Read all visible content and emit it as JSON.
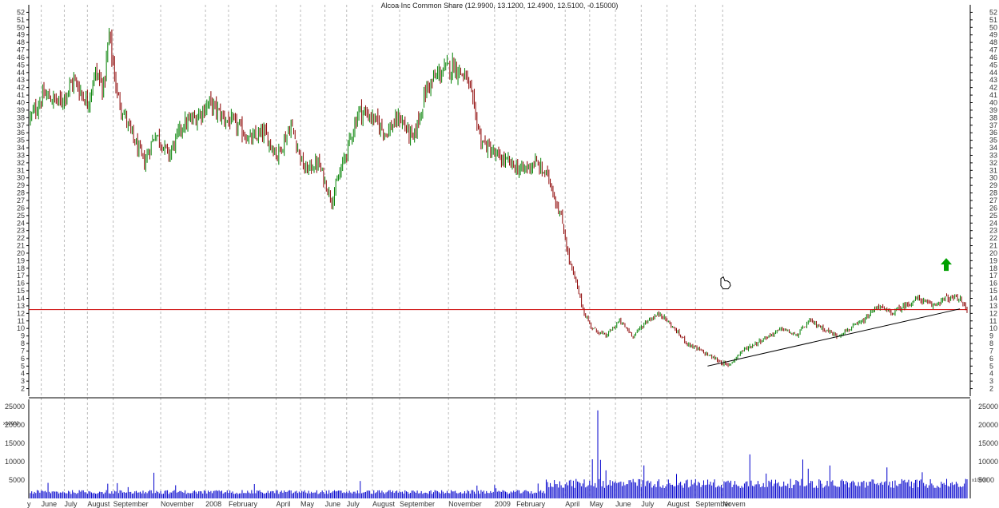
{
  "chart_data": [
    {
      "type": "candlestick",
      "title": "Alcoa Inc Common Share (12.9900, 13.1200, 12.4900, 12.5100, -0.15000)",
      "ylim": [
        1,
        53
      ],
      "y_ticks": [
        "2",
        "3",
        "4",
        "5",
        "6",
        "7",
        "8",
        "9",
        "10",
        "11",
        "12",
        "13",
        "14",
        "15",
        "16",
        "17",
        "18",
        "19",
        "20",
        "21",
        "22",
        "23",
        "24",
        "25",
        "26",
        "27",
        "28",
        "29",
        "30",
        "31",
        "32",
        "33",
        "34",
        "35",
        "36",
        "37",
        "38",
        "39",
        "40",
        "41",
        "42",
        "43",
        "44",
        "45",
        "46",
        "47",
        "48",
        "49",
        "50",
        "51",
        "52"
      ],
      "x_labels": [
        "y",
        "June",
        "July",
        "August",
        "September",
        "November",
        "2008",
        "February",
        "April",
        "May",
        "June",
        "July",
        "August",
        "September",
        "November",
        "2009",
        "February",
        "April",
        "May",
        "June",
        "July",
        "August",
        "September",
        "Novem"
      ],
      "bars_per_label_gap": [
        8,
        17,
        17,
        19,
        35,
        33,
        17,
        35,
        18,
        18,
        16,
        19,
        20,
        36,
        34,
        16,
        36,
        18,
        19,
        19,
        19,
        21,
        20
      ],
      "price_path": [
        [
          0,
          38
        ],
        [
          10,
          41
        ],
        [
          22,
          40
        ],
        [
          32,
          43
        ],
        [
          42,
          40
        ],
        [
          48,
          44
        ],
        [
          54,
          42
        ],
        [
          58,
          49
        ],
        [
          64,
          41
        ],
        [
          74,
          36
        ],
        [
          84,
          32
        ],
        [
          92,
          36
        ],
        [
          102,
          33
        ],
        [
          112,
          37
        ],
        [
          122,
          38
        ],
        [
          132,
          40
        ],
        [
          142,
          38
        ],
        [
          152,
          37
        ],
        [
          162,
          35
        ],
        [
          172,
          36
        ],
        [
          182,
          33
        ],
        [
          192,
          37
        ],
        [
          202,
          31
        ],
        [
          212,
          32
        ],
        [
          222,
          27
        ],
        [
          232,
          33
        ],
        [
          242,
          39
        ],
        [
          252,
          38
        ],
        [
          262,
          36
        ],
        [
          272,
          38
        ],
        [
          282,
          35
        ],
        [
          292,
          42
        ],
        [
          302,
          44
        ],
        [
          312,
          45
        ],
        [
          322,
          43
        ],
        [
          332,
          35
        ],
        [
          342,
          33
        ],
        [
          352,
          32
        ],
        [
          362,
          31
        ],
        [
          372,
          32
        ],
        [
          382,
          30
        ],
        [
          392,
          24
        ],
        [
          397,
          19
        ],
        [
          402,
          16
        ],
        [
          408,
          12
        ],
        [
          414,
          10
        ],
        [
          424,
          9
        ],
        [
          434,
          11
        ],
        [
          444,
          9
        ],
        [
          454,
          11
        ],
        [
          464,
          12
        ],
        [
          474,
          10
        ],
        [
          484,
          8
        ],
        [
          494,
          7
        ],
        [
          504,
          6
        ],
        [
          514,
          5
        ],
        [
          524,
          7
        ],
        [
          534,
          8
        ],
        [
          544,
          9
        ],
        [
          554,
          10
        ],
        [
          564,
          9
        ],
        [
          574,
          11
        ],
        [
          584,
          10
        ],
        [
          594,
          9
        ],
        [
          604,
          10
        ],
        [
          614,
          11
        ],
        [
          624,
          13
        ],
        [
          634,
          12
        ],
        [
          644,
          13
        ],
        [
          654,
          14
        ],
        [
          664,
          13
        ],
        [
          674,
          14
        ],
        [
          684,
          14
        ],
        [
          690,
          12.5
        ]
      ],
      "trendline": {
        "from": [
          0.721,
          5.0
        ],
        "to": [
          0.989,
          12.6
        ]
      },
      "horizontal_line": 12.5,
      "annotations": [
        "up-arrow",
        "hand-pointer"
      ]
    },
    {
      "type": "bar",
      "title": "Volume",
      "scale_note": "x10000",
      "ylim": [
        0,
        27000
      ],
      "y_ticks": [
        "5000",
        "10000",
        "15000",
        "20000",
        "25000"
      ],
      "peaks": [
        {
          "near_label": "September",
          "year": "2007",
          "value": 7000
        },
        {
          "near_label": "February",
          "year": "2009",
          "value": 24000
        },
        {
          "near_label": "February",
          "year": "2009",
          "value": 10500
        },
        {
          "near_label": "July",
          "year": "2009",
          "value": 9000
        },
        {
          "near_label": "September",
          "year": "2009",
          "value": 12000
        }
      ]
    }
  ],
  "colors": {
    "up": "#008000",
    "down": "#8b0000",
    "volume": "#0000cc",
    "hline": "#cc0000",
    "trend": "#000000",
    "grid": "#bbbbbb",
    "arrow": "#00a000"
  }
}
